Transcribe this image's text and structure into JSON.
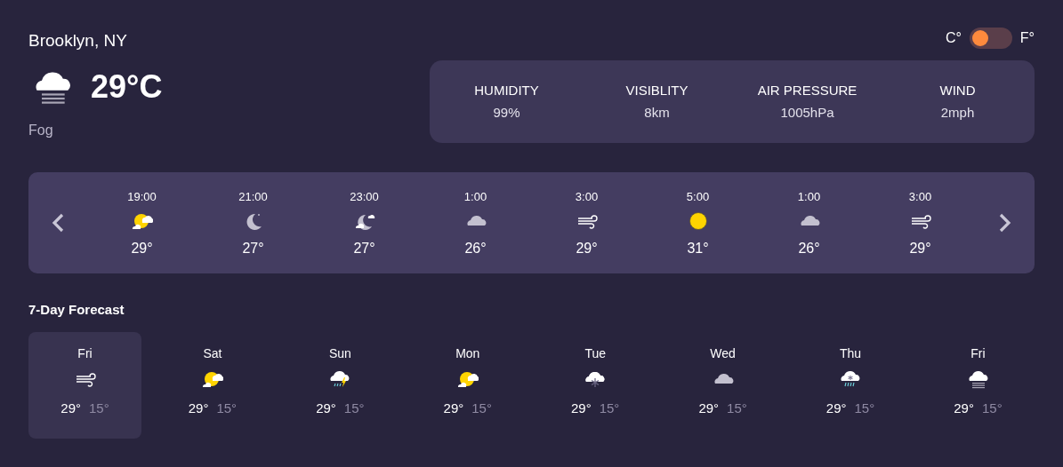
{
  "location": "Brooklyn, NY",
  "current": {
    "kind": "fog",
    "temperature": "29°C",
    "condition": "Fog"
  },
  "unit_toggle": {
    "left_label": "C°",
    "right_label": "F°",
    "on": false
  },
  "stats": [
    {
      "label": "HUMIDITY",
      "value": "99%"
    },
    {
      "label": "VISIBLITY",
      "value": "8km"
    },
    {
      "label": "AIR PRESSURE",
      "value": "1005hPa"
    },
    {
      "label": "WIND",
      "value": "2mph"
    }
  ],
  "hourly": [
    {
      "time": "19:00",
      "kind": "partly-sunny",
      "temp": "29°"
    },
    {
      "time": "21:00",
      "kind": "moon",
      "temp": "27°"
    },
    {
      "time": "23:00",
      "kind": "moon-cloud",
      "temp": "27°"
    },
    {
      "time": "1:00",
      "kind": "cloud",
      "temp": "26°"
    },
    {
      "time": "3:00",
      "kind": "wind",
      "temp": "29°"
    },
    {
      "time": "5:00",
      "kind": "sun",
      "temp": "31°"
    },
    {
      "time": "1:00",
      "kind": "cloud",
      "temp": "26°"
    },
    {
      "time": "3:00",
      "kind": "wind",
      "temp": "29°"
    }
  ],
  "forecast_title": "7-Day Forecast",
  "days": [
    {
      "day": "Fri",
      "kind": "wind",
      "high": "29°",
      "low": "15°",
      "selected": true
    },
    {
      "day": "Sat",
      "kind": "partly-sunny",
      "high": "29°",
      "low": "15°",
      "selected": false
    },
    {
      "day": "Sun",
      "kind": "thunder-rain",
      "high": "29°",
      "low": "15°",
      "selected": false
    },
    {
      "day": "Mon",
      "kind": "partly-sunny",
      "high": "29°",
      "low": "15°",
      "selected": false
    },
    {
      "day": "Tue",
      "kind": "snow",
      "high": "29°",
      "low": "15°",
      "selected": false
    },
    {
      "day": "Wed",
      "kind": "cloud",
      "high": "29°",
      "low": "15°",
      "selected": false
    },
    {
      "day": "Thu",
      "kind": "sleet",
      "high": "29°",
      "low": "15°",
      "selected": false
    },
    {
      "day": "Fri",
      "kind": "fog",
      "high": "29°",
      "low": "15°",
      "selected": false
    }
  ]
}
